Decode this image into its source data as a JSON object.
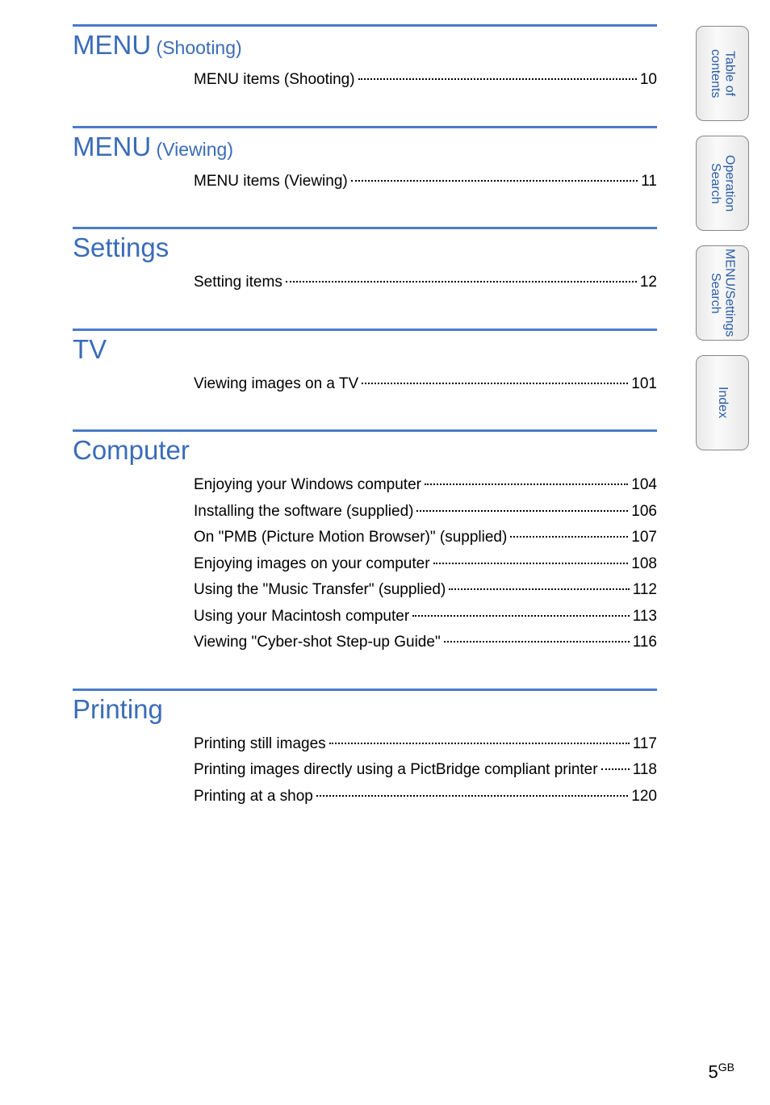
{
  "sections": [
    {
      "heading_main": "MENU",
      "heading_sub": " (Shooting)",
      "items": [
        {
          "label": "MENU items (Shooting)",
          "page": "10"
        }
      ]
    },
    {
      "heading_main": "MENU",
      "heading_sub": " (Viewing)",
      "items": [
        {
          "label": "MENU items (Viewing)",
          "page": "11"
        }
      ]
    },
    {
      "heading_main": "Settings",
      "heading_sub": "",
      "items": [
        {
          "label": "Setting items",
          "page": "12"
        }
      ]
    },
    {
      "heading_main": "TV",
      "heading_sub": "",
      "items": [
        {
          "label": "Viewing images on a TV",
          "page": "101"
        }
      ]
    },
    {
      "heading_main": "Computer",
      "heading_sub": "",
      "items": [
        {
          "label": "Enjoying your Windows computer",
          "page": "104"
        },
        {
          "label": "Installing the software (supplied)",
          "page": "106"
        },
        {
          "label": "On \"PMB (Picture Motion Browser)\" (supplied)",
          "page": "107"
        },
        {
          "label": "Enjoying images on your computer",
          "page": "108"
        },
        {
          "label": "Using the \"Music Transfer\" (supplied)",
          "page": "112"
        },
        {
          "label": "Using your Macintosh computer",
          "page": "113"
        },
        {
          "label": "Viewing \"Cyber-shot Step-up Guide\"",
          "page": "116"
        }
      ]
    },
    {
      "heading_main": "Printing",
      "heading_sub": "",
      "items": [
        {
          "label": "Printing still images",
          "page": "117"
        },
        {
          "label": "Printing images directly using a PictBridge compliant printer",
          "page": "118"
        },
        {
          "label": "Printing at a shop",
          "page": "120"
        }
      ]
    }
  ],
  "tabs": [
    "Table of\ncontents",
    "Operation\nSearch",
    "MENU/Settings\nSearch",
    "Index"
  ],
  "footer": {
    "page": "5",
    "suffix": "GB"
  }
}
